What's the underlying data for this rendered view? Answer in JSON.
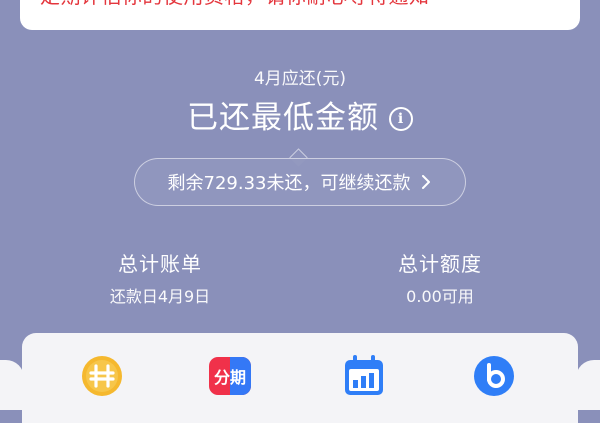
{
  "notice": {
    "text": "定期评估你的使用资格，请你耐心等待通知"
  },
  "repayment": {
    "month_label": "4月应还(元)",
    "status": "已还最低金额",
    "tip": "剩余729.33未还，可继续还款"
  },
  "stats": {
    "bill_title": "总计账单",
    "bill_sub": "还款日4月9日",
    "limit_title": "总计额度",
    "limit_sub": "0.00可用"
  },
  "shortcuts": {
    "installment_label": "分期"
  },
  "colors": {
    "background": "#8a90ba",
    "notice_red": "#e4363d",
    "coin_yellow": "#f5b82e",
    "installment_red": "#f0314a",
    "installment_blue": "#3478f6",
    "calendar_blue": "#2f7ef7"
  },
  "icons": [
    "info-icon",
    "chevron-right-icon",
    "coin-icon",
    "installment-icon",
    "calendar-icon",
    "b-logo-icon"
  ]
}
